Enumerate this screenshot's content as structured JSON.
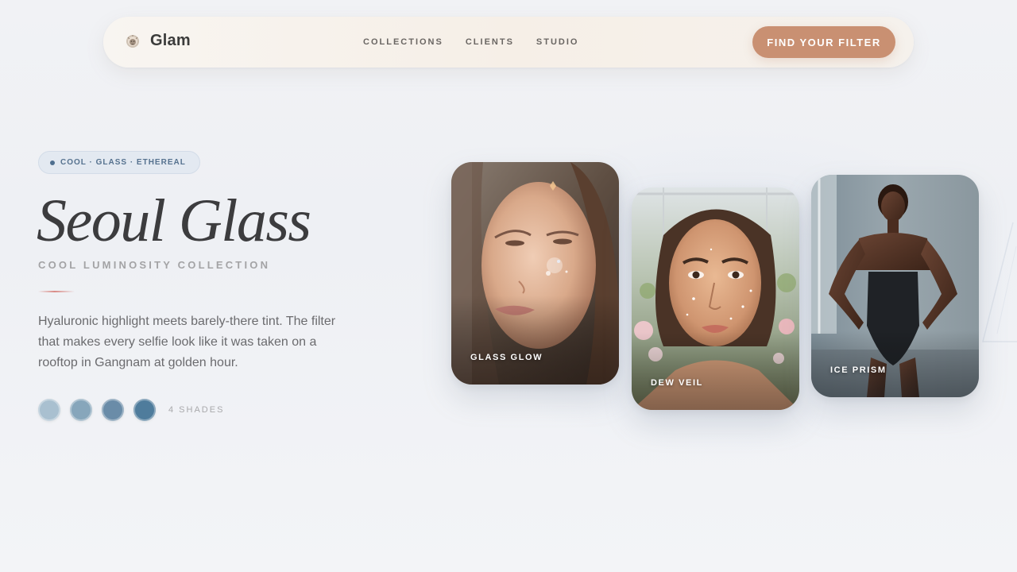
{
  "nav": {
    "brand": "Glam",
    "brand_icon": "lion-crest-icon",
    "links": [
      "COLLECTIONS",
      "CLIENTS",
      "STUDIO"
    ],
    "cta": "FIND YOUR FILTER"
  },
  "hero": {
    "tag": "COOL · GLASS · ETHEREAL",
    "title": "Seoul Glass",
    "subtitle": "COOL LUMINOSITY COLLECTION",
    "description": "Hyaluronic highlight meets barely-there tint. The filter that makes every selfie look like it was taken on a rooftop in Gangnam at golden hour.",
    "shades_label": "4 SHADES",
    "shades": [
      "#a9c0d0",
      "#87a6bb",
      "#6a8ca8",
      "#4f7c9c"
    ]
  },
  "cards": [
    {
      "label": "GLASS GLOW"
    },
    {
      "label": "DEW VEIL"
    },
    {
      "label": "ICE PRISM"
    }
  ],
  "colors": {
    "accent": "#c99072",
    "tag_text": "#56728f",
    "title": "#3c3c3e"
  }
}
